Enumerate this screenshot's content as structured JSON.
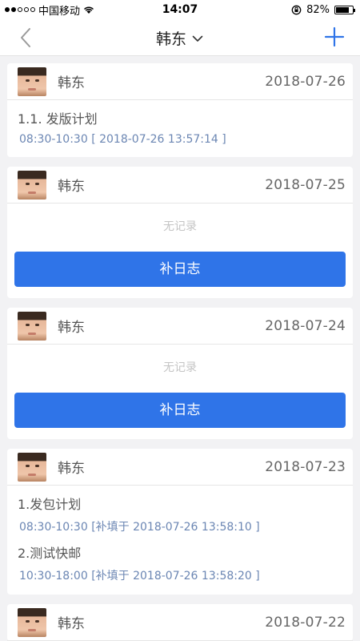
{
  "status_bar": {
    "carrier": "中国移动",
    "time": "14:07",
    "battery": "82%",
    "battery_level": 0.82
  },
  "nav": {
    "title": "韩东",
    "back_icon": "chevron-left-icon",
    "add_icon": "plus-icon",
    "caret_icon": "chevron-down-icon",
    "accent_color": "#2f74e8"
  },
  "cards": [
    {
      "name": "韩东",
      "date": "2018-07-26",
      "entries": [
        {
          "title": "1.1. 发版计划",
          "time": "08:30-10:30 [ 2018-07-26 13:57:14 ]"
        }
      ]
    },
    {
      "name": "韩东",
      "date": "2018-07-25",
      "empty_text": "无记录",
      "button_label": "补日志"
    },
    {
      "name": "韩东",
      "date": "2018-07-24",
      "empty_text": "无记录",
      "button_label": "补日志"
    },
    {
      "name": "韩东",
      "date": "2018-07-23",
      "entries": [
        {
          "title": "1.发包计划",
          "time": "08:30-10:30 [补填于 2018-07-26 13:58:10 ]"
        },
        {
          "title": "2.测试快邮",
          "time": "10:30-18:00 [补填于 2018-07-26 13:58:20 ]"
        }
      ]
    },
    {
      "name": "韩东",
      "date": "2018-07-22"
    }
  ]
}
